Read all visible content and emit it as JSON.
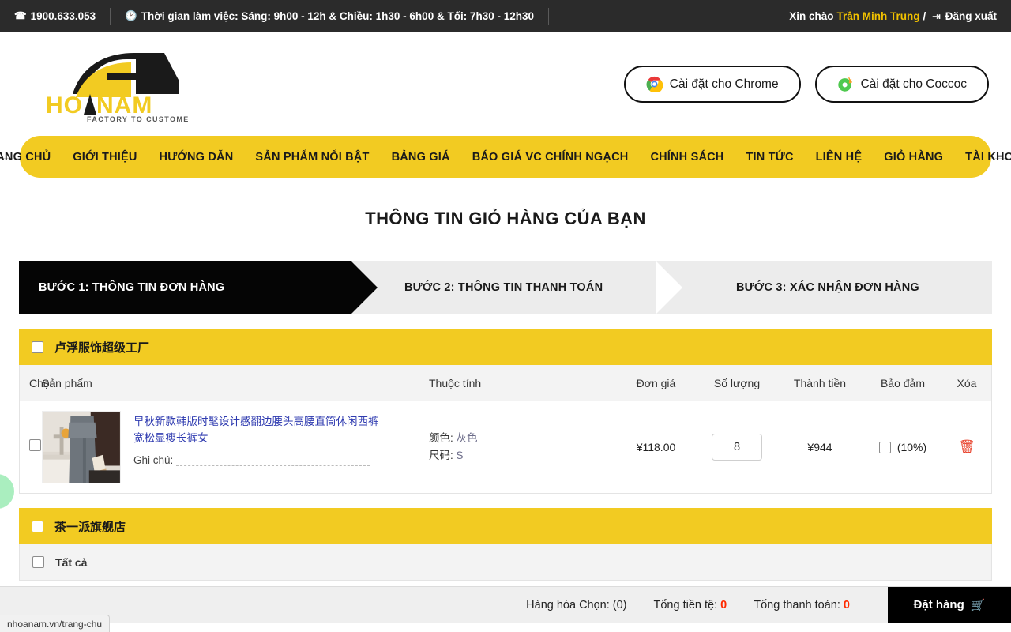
{
  "topbar": {
    "phone_icon": "phone-icon",
    "phone": "1900.633.053",
    "clock_icon": "clock-icon",
    "hours": "Thời gian làm việc: Sáng: 9h00 - 12h & Chiều: 1h30 - 6h00 & Tối: 7h30 - 12h30",
    "greeting": "Xin chào",
    "user": "Trần Minh Trung",
    "slash": "/",
    "logout": "Đăng xuất",
    "logout_icon": "logout-icon",
    "accent": "#f2c200",
    "background": "#2b2b2b"
  },
  "header": {
    "logo_main": "HOA NAM",
    "logo_tagline": "FACTORY TO CUSTOMER",
    "install_buttons": [
      {
        "label": "Cài đặt cho Chrome",
        "icon": "chrome-icon"
      },
      {
        "label": "Cài đặt cho Coccoc",
        "icon": "coccoc-icon"
      }
    ]
  },
  "nav": {
    "background": "#f2cb22",
    "items": [
      "TRANG CHỦ",
      "GIỚI THIỆU",
      "HƯỚNG DẪN",
      "SẢN PHẨM NỔI BẬT",
      "BẢNG GIÁ",
      "BÁO GIÁ VC CHÍNH NGẠCH",
      "CHÍNH SÁCH",
      "TIN TỨC",
      "LIÊN HỆ",
      "GIỎ HÀNG",
      "TÀI KHOẢN"
    ]
  },
  "page": {
    "title": "THÔNG TIN GIỎ HÀNG CỦA BẠN"
  },
  "steps": [
    {
      "label": "BƯỚC 1: THÔNG TIN ĐƠN HÀNG",
      "active": true
    },
    {
      "label": "BƯỚC 2: THÔNG TIN THANH TOÁN",
      "active": false
    },
    {
      "label": "BƯỚC 3: XÁC NHẬN ĐƠN HÀNG",
      "active": false
    }
  ],
  "cart": {
    "columns": {
      "select": "Chọn",
      "product": "Sản phẩm",
      "attributes": "Thuộc tính",
      "unit_price": "Đơn giá",
      "quantity": "Số lượng",
      "line_total": "Thành tiền",
      "insurance": "Bảo đảm",
      "delete": "Xóa"
    },
    "shops": [
      {
        "name": "卢浮服饰超级工厂",
        "items": [
          {
            "title": "早秋新款韩版时髦设计感翻边腰头高腰直筒休闲西裤宽松显瘦长裤女",
            "note_label": "Ghi chú:",
            "note_value": "",
            "attr_color_label": "颜色:",
            "attr_color_value": "灰色",
            "attr_size_label": "尺码:",
            "attr_size_value": "S",
            "unit_price": "¥118.00",
            "quantity": "8",
            "line_total": "¥944",
            "insurance_rate": "(10%)",
            "delete_icon": "trash-icon"
          }
        ]
      },
      {
        "name": "茶一派旗舰店",
        "items": []
      }
    ],
    "select_all_label": "Tất cả"
  },
  "footer": {
    "selected_label": "Hàng hóa Chọn: (0)",
    "currency_total_label": "Tổng tiền tệ:",
    "currency_total_value": "0",
    "payment_total_label": "Tổng thanh toán:",
    "payment_total_value": "0",
    "order_button": "Đặt hàng",
    "order_icon": "cart-icon",
    "accent": "#ff2a00"
  },
  "statusbar": {
    "url": "nhoanam.vn/trang-chu"
  }
}
